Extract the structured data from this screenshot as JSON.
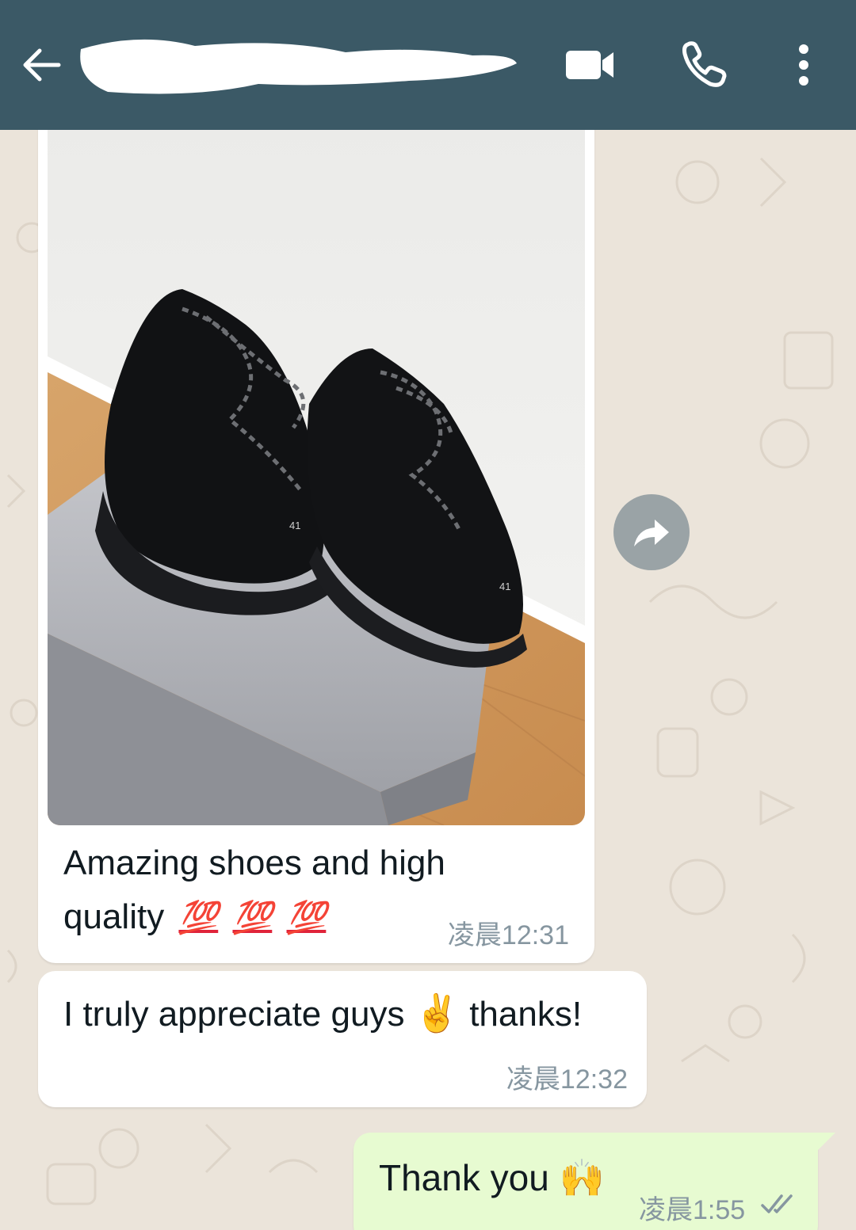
{
  "header": {
    "contact_name": "",
    "background": "#3b5966",
    "icons": [
      "back-arrow-icon",
      "video-call-icon",
      "phone-icon",
      "more-options-icon"
    ]
  },
  "messages": [
    {
      "direction": "incoming",
      "type": "image",
      "caption_line1": "Amazing shoes and high",
      "caption_line2": "quality",
      "emojis": [
        "💯",
        "💯",
        "💯"
      ],
      "time": "凌晨12:31"
    },
    {
      "direction": "incoming",
      "type": "text",
      "text_before": "I truly appreciate guys",
      "emoji": "✌️",
      "text_after": "thanks!",
      "time": "凌晨12:32"
    },
    {
      "direction": "outgoing",
      "type": "text",
      "text": "Thank you",
      "emoji": "🙌",
      "time": "凌晨1:55",
      "status": "read-double-check-icon"
    }
  ],
  "forward_button": {
    "icon": "forward-arrow-icon"
  },
  "colors": {
    "incoming_bubble": "#ffffff",
    "outgoing_bubble": "#e7fbd1",
    "chat_background": "#ebe4da",
    "timestamp": "#8696a0",
    "read_ticks": "#8696a0"
  }
}
